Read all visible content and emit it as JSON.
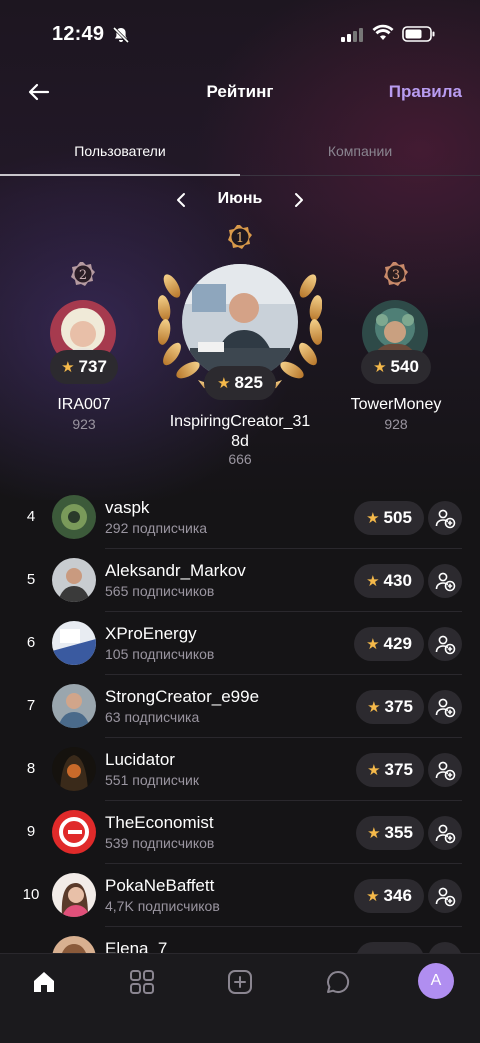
{
  "status": {
    "time": "12:49"
  },
  "header": {
    "title": "Рейтинг",
    "rules": "Правила"
  },
  "tabs": [
    {
      "label": "Пользователи"
    },
    {
      "label": "Компании"
    }
  ],
  "month": "Июнь",
  "podium": [
    {
      "place": "1",
      "name": "InspiringCreator_318d",
      "name_line1": "InspiringCreator_31",
      "name_line2": "8d",
      "count": "666",
      "stars": "825"
    },
    {
      "place": "2",
      "name": "IRA007",
      "count": "923",
      "stars": "737"
    },
    {
      "place": "3",
      "name": "TowerMoney",
      "count": "928",
      "stars": "540"
    }
  ],
  "list": [
    {
      "rank": "4",
      "name": "vaspk",
      "subs": "292 подписчика",
      "stars": "505"
    },
    {
      "rank": "5",
      "name": "Aleksandr_Markov",
      "subs": "565 подписчиков",
      "stars": "430"
    },
    {
      "rank": "6",
      "name": "XProEnergy",
      "subs": "105 подписчиков",
      "stars": "429"
    },
    {
      "rank": "7",
      "name": "StrongCreator_e99e",
      "subs": "63 подписчика",
      "stars": "375"
    },
    {
      "rank": "8",
      "name": "Lucidator",
      "subs": "551 подписчик",
      "stars": "375"
    },
    {
      "rank": "9",
      "name": "TheEconomist",
      "subs": "539 подписчиков",
      "stars": "355"
    },
    {
      "rank": "10",
      "name": "PokaNeBaffett",
      "subs": "4,7K подписчиков",
      "stars": "346"
    },
    {
      "rank": "",
      "name": "Elena_7",
      "subs": "",
      "stars": ""
    }
  ],
  "nav": {
    "avatar_letter": "A"
  },
  "colors": {
    "accent": "#b89cf0",
    "star": "#f5b94a",
    "pill": "#2c2a2f",
    "background": "#151416"
  },
  "icons": [
    "bell-off-icon",
    "signal-icon",
    "wifi-icon",
    "battery-icon",
    "arrow-left-icon",
    "chevron-left-icon",
    "chevron-right-icon",
    "star-icon",
    "add-user-icon",
    "home-icon",
    "grid-icon",
    "plus-square-icon",
    "chat-icon"
  ]
}
